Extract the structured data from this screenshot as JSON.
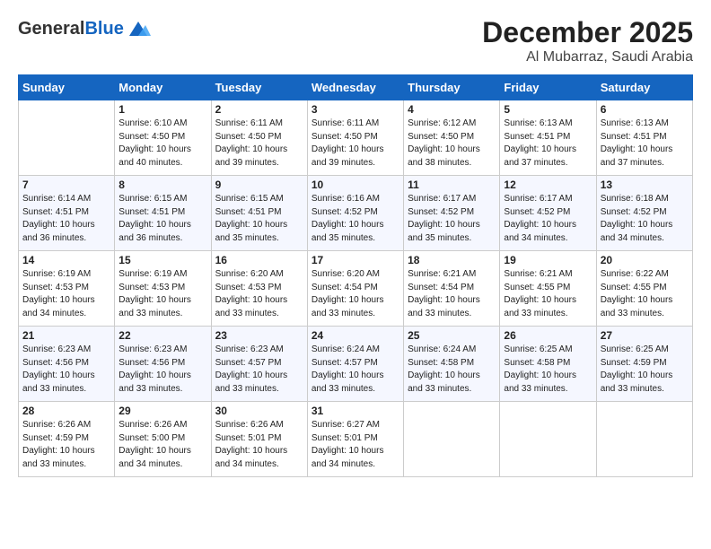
{
  "logo": {
    "general": "General",
    "blue": "Blue"
  },
  "header": {
    "month": "December 2025",
    "location": "Al Mubarraz, Saudi Arabia"
  },
  "days": [
    "Sunday",
    "Monday",
    "Tuesday",
    "Wednesday",
    "Thursday",
    "Friday",
    "Saturday"
  ],
  "weeks": [
    [
      {
        "day": "",
        "sunrise": "",
        "sunset": "",
        "daylight": ""
      },
      {
        "day": "1",
        "sunrise": "Sunrise: 6:10 AM",
        "sunset": "Sunset: 4:50 PM",
        "daylight": "Daylight: 10 hours and 40 minutes."
      },
      {
        "day": "2",
        "sunrise": "Sunrise: 6:11 AM",
        "sunset": "Sunset: 4:50 PM",
        "daylight": "Daylight: 10 hours and 39 minutes."
      },
      {
        "day": "3",
        "sunrise": "Sunrise: 6:11 AM",
        "sunset": "Sunset: 4:50 PM",
        "daylight": "Daylight: 10 hours and 39 minutes."
      },
      {
        "day": "4",
        "sunrise": "Sunrise: 6:12 AM",
        "sunset": "Sunset: 4:50 PM",
        "daylight": "Daylight: 10 hours and 38 minutes."
      },
      {
        "day": "5",
        "sunrise": "Sunrise: 6:13 AM",
        "sunset": "Sunset: 4:51 PM",
        "daylight": "Daylight: 10 hours and 37 minutes."
      },
      {
        "day": "6",
        "sunrise": "Sunrise: 6:13 AM",
        "sunset": "Sunset: 4:51 PM",
        "daylight": "Daylight: 10 hours and 37 minutes."
      }
    ],
    [
      {
        "day": "7",
        "sunrise": "Sunrise: 6:14 AM",
        "sunset": "Sunset: 4:51 PM",
        "daylight": "Daylight: 10 hours and 36 minutes."
      },
      {
        "day": "8",
        "sunrise": "Sunrise: 6:15 AM",
        "sunset": "Sunset: 4:51 PM",
        "daylight": "Daylight: 10 hours and 36 minutes."
      },
      {
        "day": "9",
        "sunrise": "Sunrise: 6:15 AM",
        "sunset": "Sunset: 4:51 PM",
        "daylight": "Daylight: 10 hours and 35 minutes."
      },
      {
        "day": "10",
        "sunrise": "Sunrise: 6:16 AM",
        "sunset": "Sunset: 4:52 PM",
        "daylight": "Daylight: 10 hours and 35 minutes."
      },
      {
        "day": "11",
        "sunrise": "Sunrise: 6:17 AM",
        "sunset": "Sunset: 4:52 PM",
        "daylight": "Daylight: 10 hours and 35 minutes."
      },
      {
        "day": "12",
        "sunrise": "Sunrise: 6:17 AM",
        "sunset": "Sunset: 4:52 PM",
        "daylight": "Daylight: 10 hours and 34 minutes."
      },
      {
        "day": "13",
        "sunrise": "Sunrise: 6:18 AM",
        "sunset": "Sunset: 4:52 PM",
        "daylight": "Daylight: 10 hours and 34 minutes."
      }
    ],
    [
      {
        "day": "14",
        "sunrise": "Sunrise: 6:19 AM",
        "sunset": "Sunset: 4:53 PM",
        "daylight": "Daylight: 10 hours and 34 minutes."
      },
      {
        "day": "15",
        "sunrise": "Sunrise: 6:19 AM",
        "sunset": "Sunset: 4:53 PM",
        "daylight": "Daylight: 10 hours and 33 minutes."
      },
      {
        "day": "16",
        "sunrise": "Sunrise: 6:20 AM",
        "sunset": "Sunset: 4:53 PM",
        "daylight": "Daylight: 10 hours and 33 minutes."
      },
      {
        "day": "17",
        "sunrise": "Sunrise: 6:20 AM",
        "sunset": "Sunset: 4:54 PM",
        "daylight": "Daylight: 10 hours and 33 minutes."
      },
      {
        "day": "18",
        "sunrise": "Sunrise: 6:21 AM",
        "sunset": "Sunset: 4:54 PM",
        "daylight": "Daylight: 10 hours and 33 minutes."
      },
      {
        "day": "19",
        "sunrise": "Sunrise: 6:21 AM",
        "sunset": "Sunset: 4:55 PM",
        "daylight": "Daylight: 10 hours and 33 minutes."
      },
      {
        "day": "20",
        "sunrise": "Sunrise: 6:22 AM",
        "sunset": "Sunset: 4:55 PM",
        "daylight": "Daylight: 10 hours and 33 minutes."
      }
    ],
    [
      {
        "day": "21",
        "sunrise": "Sunrise: 6:23 AM",
        "sunset": "Sunset: 4:56 PM",
        "daylight": "Daylight: 10 hours and 33 minutes."
      },
      {
        "day": "22",
        "sunrise": "Sunrise: 6:23 AM",
        "sunset": "Sunset: 4:56 PM",
        "daylight": "Daylight: 10 hours and 33 minutes."
      },
      {
        "day": "23",
        "sunrise": "Sunrise: 6:23 AM",
        "sunset": "Sunset: 4:57 PM",
        "daylight": "Daylight: 10 hours and 33 minutes."
      },
      {
        "day": "24",
        "sunrise": "Sunrise: 6:24 AM",
        "sunset": "Sunset: 4:57 PM",
        "daylight": "Daylight: 10 hours and 33 minutes."
      },
      {
        "day": "25",
        "sunrise": "Sunrise: 6:24 AM",
        "sunset": "Sunset: 4:58 PM",
        "daylight": "Daylight: 10 hours and 33 minutes."
      },
      {
        "day": "26",
        "sunrise": "Sunrise: 6:25 AM",
        "sunset": "Sunset: 4:58 PM",
        "daylight": "Daylight: 10 hours and 33 minutes."
      },
      {
        "day": "27",
        "sunrise": "Sunrise: 6:25 AM",
        "sunset": "Sunset: 4:59 PM",
        "daylight": "Daylight: 10 hours and 33 minutes."
      }
    ],
    [
      {
        "day": "28",
        "sunrise": "Sunrise: 6:26 AM",
        "sunset": "Sunset: 4:59 PM",
        "daylight": "Daylight: 10 hours and 33 minutes."
      },
      {
        "day": "29",
        "sunrise": "Sunrise: 6:26 AM",
        "sunset": "Sunset: 5:00 PM",
        "daylight": "Daylight: 10 hours and 34 minutes."
      },
      {
        "day": "30",
        "sunrise": "Sunrise: 6:26 AM",
        "sunset": "Sunset: 5:01 PM",
        "daylight": "Daylight: 10 hours and 34 minutes."
      },
      {
        "day": "31",
        "sunrise": "Sunrise: 6:27 AM",
        "sunset": "Sunset: 5:01 PM",
        "daylight": "Daylight: 10 hours and 34 minutes."
      },
      {
        "day": "",
        "sunrise": "",
        "sunset": "",
        "daylight": ""
      },
      {
        "day": "",
        "sunrise": "",
        "sunset": "",
        "daylight": ""
      },
      {
        "day": "",
        "sunrise": "",
        "sunset": "",
        "daylight": ""
      }
    ]
  ]
}
